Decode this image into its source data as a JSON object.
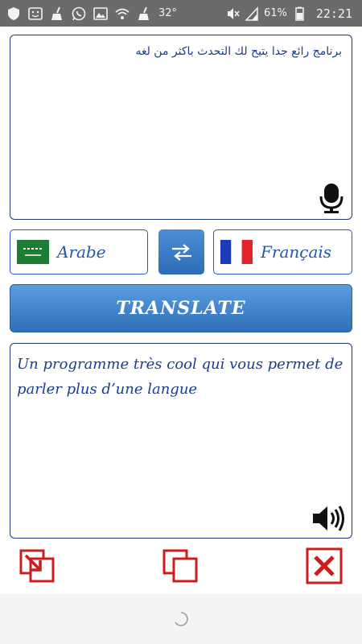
{
  "status_bar": {
    "temperature": "32°",
    "battery": "61%",
    "time": "22:21",
    "left_icons": [
      "shield-icon",
      "face-icon",
      "broom-icon",
      "whatsapp-icon",
      "image-icon",
      "wifi-icon",
      "broom-icon"
    ],
    "right_icons": [
      "mute-icon",
      "signal-icon",
      "battery-icon"
    ]
  },
  "source": {
    "text": "برنامج رائع جدا يتيح لك التحدث باكثر من لغه",
    "mic_icon": "microphone-icon"
  },
  "languages": {
    "source_label": "Arabe",
    "source_flag": "saudi-arabia-flag",
    "target_label": "Français",
    "target_flag": "france-flag",
    "swap_icon": "swap-arrows-icon"
  },
  "translate_button": {
    "label": "TRANSLATE"
  },
  "target": {
    "text": "Un programme très cool qui vous permet de parler plus d’une langue",
    "speaker_icon": "speaker-icon"
  },
  "actions": {
    "share_icon": "share-icon",
    "copy_icon": "copy-icon",
    "clear_icon": "clear-icon"
  },
  "colors": {
    "status_bar": "#6b6b6b",
    "accent_blue": "#2f6fb6",
    "text_blue": "#1a3d8f",
    "action_red": "#cc1d1d"
  }
}
